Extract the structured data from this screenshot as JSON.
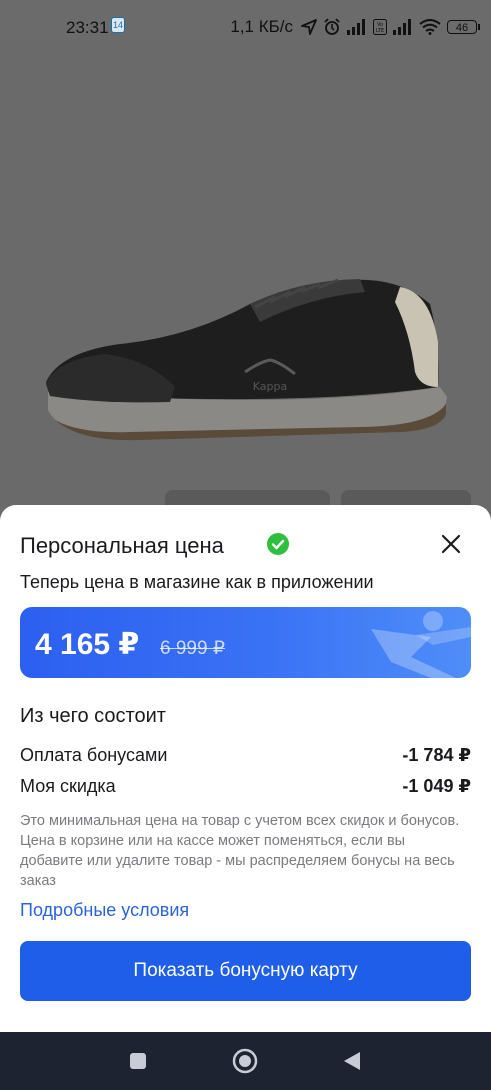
{
  "status_bar": {
    "time": "23:31",
    "calendar_day": "14",
    "net_speed": "1,1 КБ/с",
    "battery": "46"
  },
  "product": {
    "image": "sneaker-photo",
    "brand_on_shoe": "Kappa"
  },
  "sheet": {
    "title": "Персональная цена",
    "subtitle": "Теперь цена в магазине как в приложении",
    "price": {
      "current": "4 165 ₽",
      "old": "6 999 ₽"
    },
    "composition_title": "Из чего состоит",
    "rows": [
      {
        "label": "Оплата бонусами",
        "value": "-1 784 ₽"
      },
      {
        "label": "Моя скидка",
        "value": "-1 049 ₽"
      }
    ],
    "note": "Это минимальная цена на товар с учетом всех скидок и бонусов. Цена в корзине или на кассе может поменяться, если вы добавите или удалите товар - мы распределяем бонусы на весь заказ",
    "terms_link": "Подробные условия",
    "cta_label": "Показать бонусную карту"
  },
  "colors": {
    "accent": "#1f5ee8",
    "link": "#2964d8",
    "verified": "#2fbf3f",
    "nav_bg": "#1d2331"
  }
}
